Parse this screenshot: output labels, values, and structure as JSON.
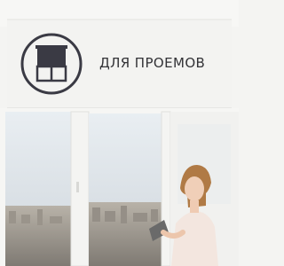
{
  "caption": "ДЛЯ ПРОЕМОВ",
  "icon": "window-blind-icon",
  "colors": {
    "icon_dark": "#3a3a44",
    "text": "#333337",
    "blind": "#f2f2f0",
    "sky": "#dfe5ea",
    "frame": "#ffffff"
  }
}
